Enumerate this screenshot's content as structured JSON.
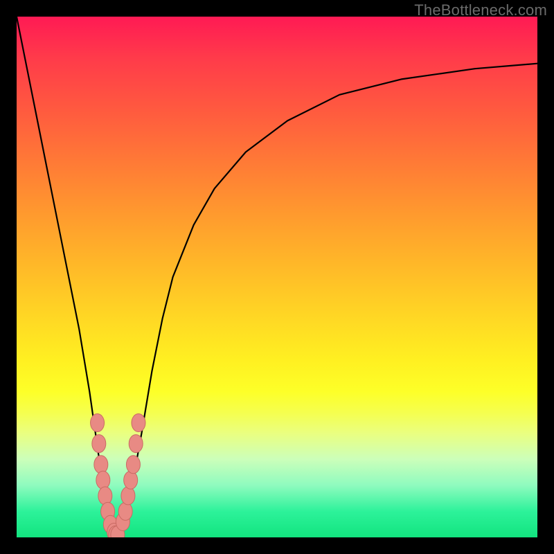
{
  "watermark": "TheBottleneck.com",
  "colors": {
    "frame": "#000000",
    "curve": "#000000",
    "marker_fill": "#e88a84",
    "marker_stroke": "#c96a63"
  },
  "chart_data": {
    "type": "line",
    "title": "",
    "xlabel": "",
    "ylabel": "",
    "xlim": [
      0,
      100
    ],
    "ylim": [
      0,
      100
    ],
    "grid": false,
    "legend": false,
    "series": [
      {
        "name": "bottleneck-curve",
        "x": [
          0,
          2,
          4,
          6,
          8,
          10,
          12,
          14,
          16,
          17,
          18,
          19,
          20,
          22,
          24,
          26,
          28,
          30,
          34,
          38,
          44,
          52,
          62,
          74,
          88,
          100
        ],
        "y": [
          100,
          90,
          80,
          70,
          60,
          50,
          40,
          28,
          14,
          7,
          2,
          0,
          2,
          9,
          20,
          32,
          42,
          50,
          60,
          67,
          74,
          80,
          85,
          88,
          90,
          91
        ]
      }
    ],
    "markers": {
      "name": "highlighted-points",
      "x": [
        15.5,
        15.8,
        16.2,
        16.6,
        17.0,
        17.5,
        18.0,
        18.7,
        19.0,
        19.4,
        20.4,
        20.9,
        21.4,
        21.9,
        22.4,
        22.9,
        23.4
      ],
      "y": [
        22,
        18,
        14,
        11,
        8,
        5,
        2.5,
        1,
        0.5,
        0.5,
        3,
        5,
        8,
        11,
        14,
        18,
        22
      ]
    }
  }
}
